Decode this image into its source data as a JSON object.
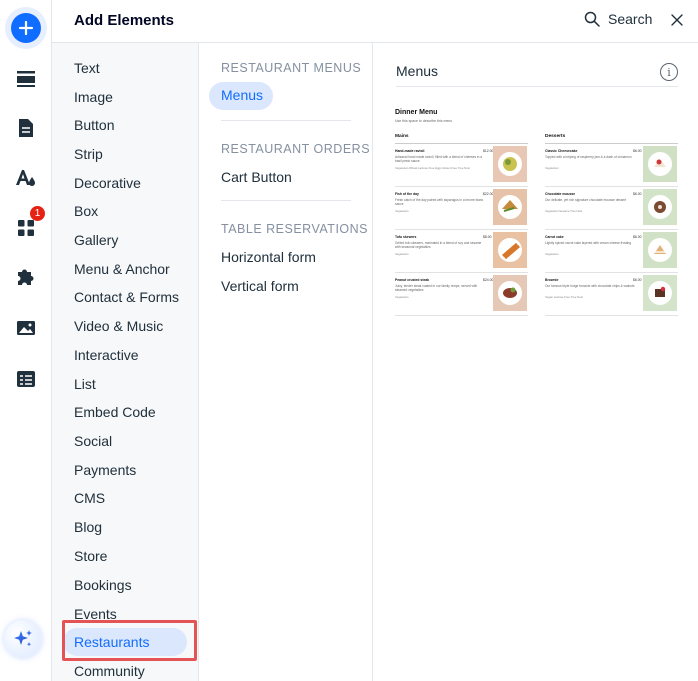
{
  "header": {
    "title": "Add Elements",
    "search_label": "Search"
  },
  "rail": {
    "apps_badge": "1"
  },
  "categories": [
    "Text",
    "Image",
    "Button",
    "Strip",
    "Decorative",
    "Box",
    "Gallery",
    "Menu & Anchor",
    "Contact & Forms",
    "Video & Music",
    "Interactive",
    "List",
    "Embed Code",
    "Social",
    "Payments",
    "CMS",
    "Blog",
    "Store",
    "Bookings",
    "Events",
    "Restaurants",
    "Community"
  ],
  "selected_category": "Restaurants",
  "sections": [
    {
      "title": "RESTAURANT MENUS",
      "items": [
        "Menus"
      ]
    },
    {
      "title": "RESTAURANT ORDERS",
      "items": [
        "Cart Button"
      ]
    },
    {
      "title": "TABLE RESERVATIONS",
      "items": [
        "Horizontal form",
        "Vertical form"
      ]
    }
  ],
  "preview": {
    "title": "Menus",
    "card": {
      "title": "Dinner Menu",
      "subtitle": "Use this space to describe this menu",
      "sections": [
        {
          "name": "Mains",
          "dishes": [
            {
              "name": "Hand-made ravioli",
              "price": "$12.00",
              "desc": "Artisanal hand made ravioli, filled with a blend of cheeses in a basil pesto sauce",
              "tags": "Vegetarian  Wheat  Lactose Free  Eggs  Gluten Free  Tree Nuts"
            },
            {
              "name": "Fish of the day",
              "price": "$22.00",
              "desc": "Fresh catch of the day paired with asparagus in a beurre blanc sauce",
              "tags": "Vegetarian"
            },
            {
              "name": "Tofu skewers",
              "price": "$8.00",
              "desc": "Grilled tofu skewers, marinated in a blend of soy and sesame with seasonal vegetables",
              "tags": "Vegetarian"
            },
            {
              "name": "Peanut crusted steak",
              "price": "$24.00",
              "desc": "Juicy, tender steak coated in our family recipe, served with steamed vegetables",
              "tags": "Vegetarian"
            }
          ]
        },
        {
          "name": "Desserts",
          "dishes": [
            {
              "name": "Classic Cheesecake",
              "price": "$6.00",
              "desc": "Topped with a helping of raspberry jam & a dash of cinnamon",
              "tags": "Vegetarian"
            },
            {
              "name": "Chocolate mousse",
              "price": "$6.00",
              "desc": "Our delicate, yet rich signature chocolate mousse dessert",
              "tags": "Vegetarian  Sesame  Tree Nuts"
            },
            {
              "name": "Carrot cake",
              "price": "$6.00",
              "desc": "Lightly spiced carrot cake layered with cream cheese frosting",
              "tags": "Vegetarian"
            },
            {
              "name": "Brownie",
              "price": "$6.00",
              "desc": "Our famous triple fudge brownie with chocolate chips & walnuts",
              "tags": "Vegan  Lactose Free  Tree Nuts"
            }
          ]
        }
      ]
    }
  },
  "colors": {
    "accent": "#116dff",
    "selection_bg": "#dbe7fd",
    "highlight_border": "#e55454",
    "badge": "#e62214"
  }
}
